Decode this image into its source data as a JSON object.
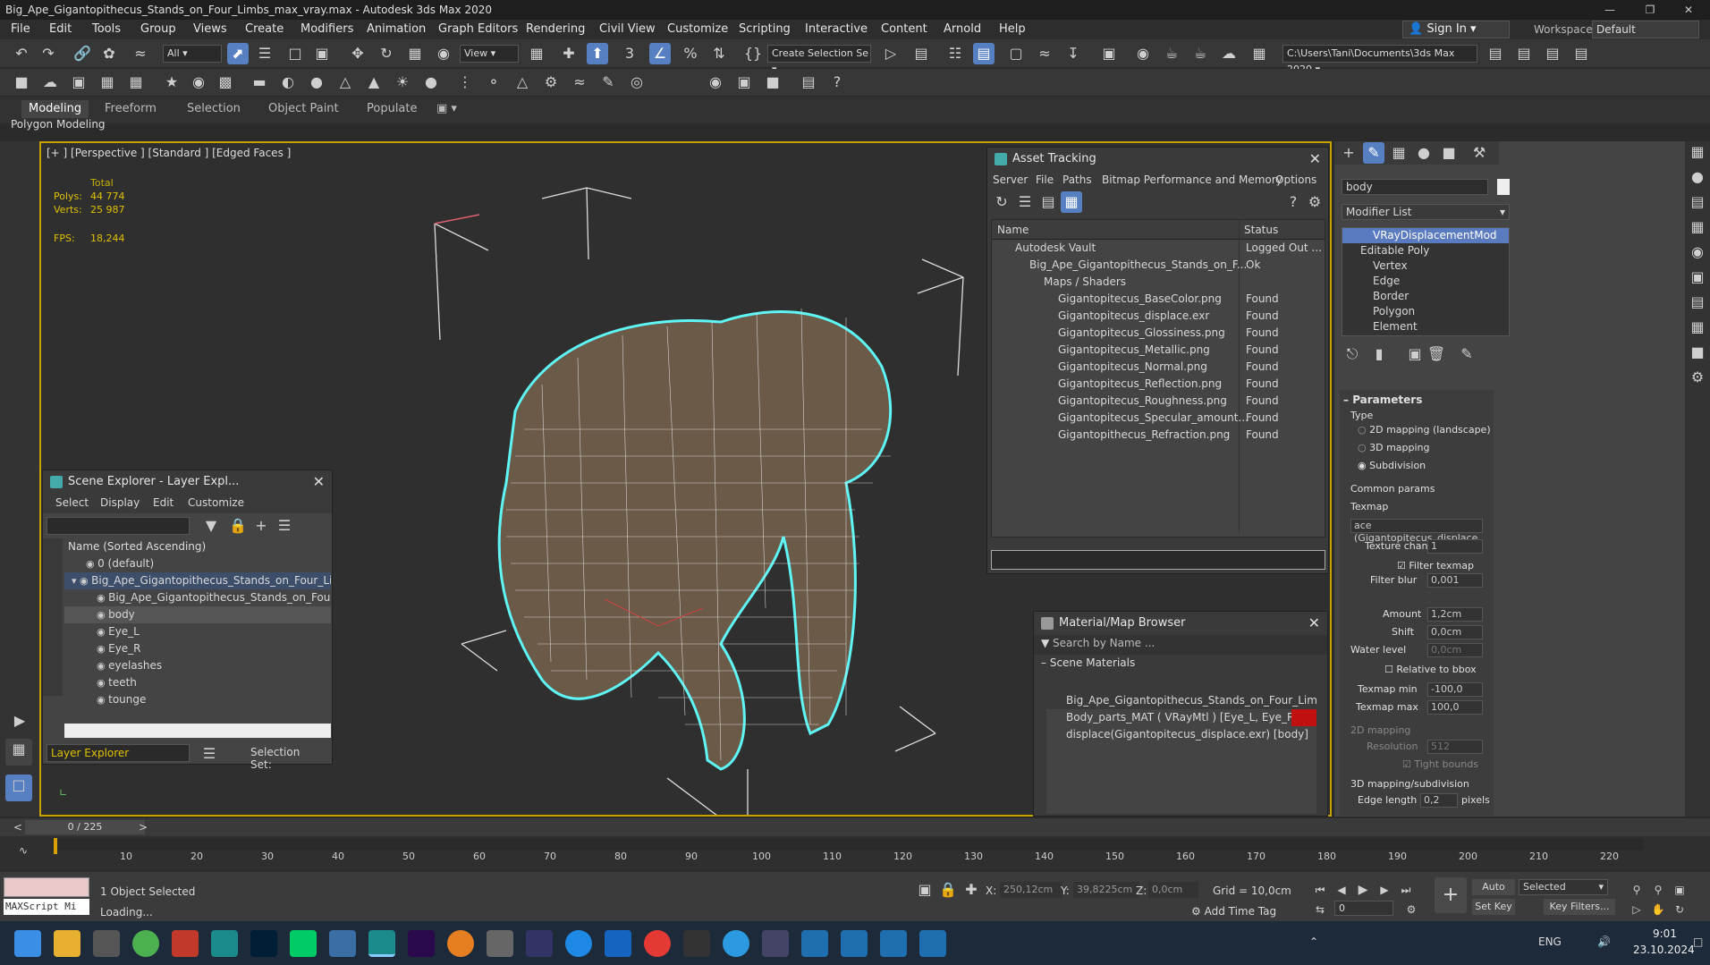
{
  "window": {
    "title": "Big_Ape_Gigantopithecus_Stands_on_Four_Limbs_max_vray.max - Autodesk 3ds Max 2020"
  },
  "menu": [
    "File",
    "Edit",
    "Tools",
    "Group",
    "Views",
    "Create",
    "Modifiers",
    "Animation",
    "Graph Editors",
    "Rendering",
    "Civil View",
    "Customize",
    "Scripting",
    "Interactive",
    "Content",
    "Arnold",
    "Help"
  ],
  "signin": "Sign In",
  "workspaces": {
    "label": "Workspaces:",
    "value": "Default"
  },
  "toolbar": {
    "filter": "All",
    "view": "View",
    "selection_set": "Create Selection Se",
    "path": "C:\\Users\\Tani\\Documents\\3ds Max 2020"
  },
  "ribbon": {
    "tabs": [
      "Modeling",
      "Freeform",
      "Selection",
      "Object Paint",
      "Populate"
    ],
    "sub": "Polygon Modeling"
  },
  "viewport": {
    "label": "[+ ] [Perspective ] [Standard ] [Edged Faces ]",
    "stats": {
      "total_label": "Total",
      "polys_label": "Polys:",
      "polys": "44 774",
      "verts_label": "Verts:",
      "verts": "25 987",
      "fps_label": "FPS:",
      "fps": "18,244"
    }
  },
  "scene_explorer": {
    "title": "Scene Explorer - Layer Expl...",
    "menu": [
      "Select",
      "Display",
      "Edit",
      "Customize"
    ],
    "column": "Name (Sorted Ascending)",
    "rows": [
      {
        "name": "0 (default)",
        "indent": 1
      },
      {
        "name": "Big_Ape_Gigantopithecus_Stands_on_Four_Limbs",
        "indent": 1
      },
      {
        "name": "Big_Ape_Gigantopithecus_Stands_on_Four_Lim",
        "indent": 2
      },
      {
        "name": "body",
        "indent": 2
      },
      {
        "name": "Eye_L",
        "indent": 2
      },
      {
        "name": "Eye_R",
        "indent": 2
      },
      {
        "name": "eyelashes",
        "indent": 2
      },
      {
        "name": "teeth",
        "indent": 2
      },
      {
        "name": "tounge",
        "indent": 2
      }
    ],
    "footer": "Layer Explorer",
    "selection_set": "Selection Set:"
  },
  "asset_tracking": {
    "title": "Asset Tracking",
    "menu": [
      "Server",
      "File",
      "Paths",
      "Bitmap Performance and Memory",
      "Options"
    ],
    "columns": [
      "Name",
      "Status"
    ],
    "rows": [
      {
        "name": "Autodesk Vault",
        "status": "Logged Out ...",
        "indent": 1
      },
      {
        "name": "Big_Ape_Gigantopithecus_Stands_on_F...",
        "status": "Ok",
        "indent": 2
      },
      {
        "name": "Maps / Shaders",
        "status": "",
        "indent": 3
      },
      {
        "name": "Gigantopitecus_BaseColor.png",
        "status": "Found",
        "indent": 4
      },
      {
        "name": "Gigantopitecus_displace.exr",
        "status": "Found",
        "indent": 4
      },
      {
        "name": "Gigantopitecus_Glossiness.png",
        "status": "Found",
        "indent": 4
      },
      {
        "name": "Gigantopitecus_Metallic.png",
        "status": "Found",
        "indent": 4
      },
      {
        "name": "Gigantopitecus_Normal.png",
        "status": "Found",
        "indent": 4
      },
      {
        "name": "Gigantopitecus_Reflection.png",
        "status": "Found",
        "indent": 4
      },
      {
        "name": "Gigantopitecus_Roughness.png",
        "status": "Found",
        "indent": 4
      },
      {
        "name": "Gigantopitecus_Specular_amount...",
        "status": "Found",
        "indent": 4
      },
      {
        "name": "Gigantopithecus_Refraction.png",
        "status": "Found",
        "indent": 4
      }
    ]
  },
  "material_browser": {
    "title": "Material/Map Browser",
    "search": "Search by Name ...",
    "section": "Scene Materials",
    "rows": [
      "Big_Ape_Gigantopithecus_Stands_on_Four_Limbs_...",
      "Body_parts_MAT  ( VRayMtl ) [Eye_L, Eye_R]",
      "displace(Gigantopitecus_displace.exr) [body]"
    ]
  },
  "command_panel": {
    "object_name": "body",
    "modifier_list": "Modifier List",
    "stack": [
      "VRayDisplacementMod",
      "Editable Poly",
      "Vertex",
      "Edge",
      "Border",
      "Polygon",
      "Element"
    ],
    "parameters": "Parameters",
    "type_label": "Type",
    "type_options": [
      "2D mapping (landscape)",
      "3D mapping",
      "Subdivision"
    ],
    "common_params": "Common params",
    "texmap_label": "Texmap",
    "texmap_value": "ace (Gigantopitecus_displace.",
    "texture_chan_label": "Texture chan",
    "texture_chan": "1",
    "filter_texmap": "Filter texmap",
    "filter_blur_label": "Filter blur",
    "filter_blur": "0,001",
    "amount_label": "Amount",
    "amount": "1,2cm",
    "shift_label": "Shift",
    "shift": "0,0cm",
    "water_level_label": "Water level",
    "water_level": "0,0cm",
    "relative_bbox": "Relative to bbox",
    "texmap_min_label": "Texmap min",
    "texmap_min": "-100,0",
    "texmap_max_label": "Texmap max",
    "texmap_max": "100,0",
    "mapping2d": "2D mapping",
    "resolution_label": "Resolution",
    "resolution": "512",
    "tight_bounds": "Tight bounds",
    "mapping3d": "3D mapping/subdivision",
    "edge_length_label": "Edge length",
    "edge_length": "0,2",
    "pixels": "pixels"
  },
  "timeline": {
    "frame": "0 / 225",
    "ticks": [
      "10",
      "20",
      "30",
      "40",
      "50",
      "60",
      "70",
      "80",
      "90",
      "100",
      "110",
      "120",
      "130",
      "140",
      "150",
      "160",
      "170",
      "180",
      "190",
      "200",
      "210",
      "220"
    ]
  },
  "status": {
    "script": "MAXScript Mi",
    "selected": "1 Object Selected",
    "loading": "Loading...",
    "x_label": "X:",
    "x": "250,12cm",
    "y_label": "Y:",
    "y": "39,8225cm",
    "z_label": "Z:",
    "z": "0,0cm",
    "grid": "Grid = 10,0cm",
    "add_time_tag": "Add Time Tag",
    "auto_key": "Auto Key",
    "key_mode": "Selected",
    "set_key": "Set Key",
    "key_filters": "Key Filters...",
    "frame_field": "0"
  },
  "taskbar": {
    "lang": "ENG",
    "time": "9:01",
    "date": "23.10.2024"
  }
}
